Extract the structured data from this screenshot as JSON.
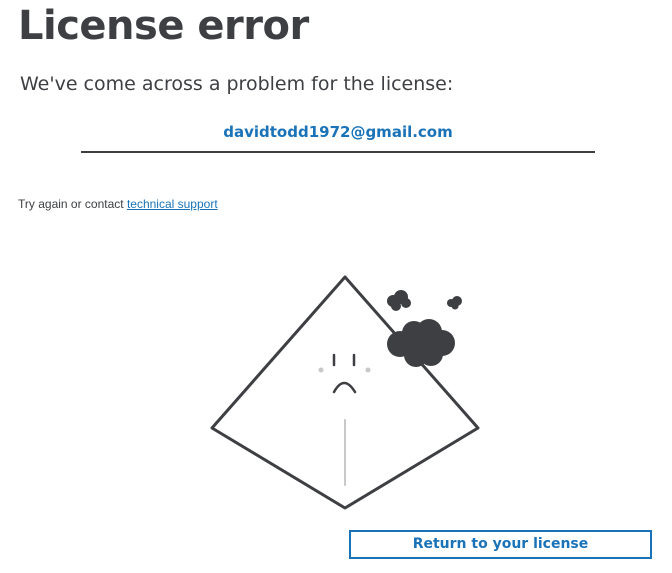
{
  "header": {
    "title": "License error"
  },
  "message": {
    "subtitle": "We've come across a problem for the license:",
    "email": "davidtodd1972@gmail.com"
  },
  "help": {
    "prefix": "Try again or contact ",
    "link_label": "technical support"
  },
  "illustration": {
    "icon": "sad-diamond-with-smoke-icon"
  },
  "actions": {
    "return_label": "Return to your license"
  },
  "colors": {
    "accent": "#1a73b8",
    "text": "#3d3f42",
    "illustration_stroke": "#3d3f42",
    "illustration_muted": "#c8c8c8"
  }
}
